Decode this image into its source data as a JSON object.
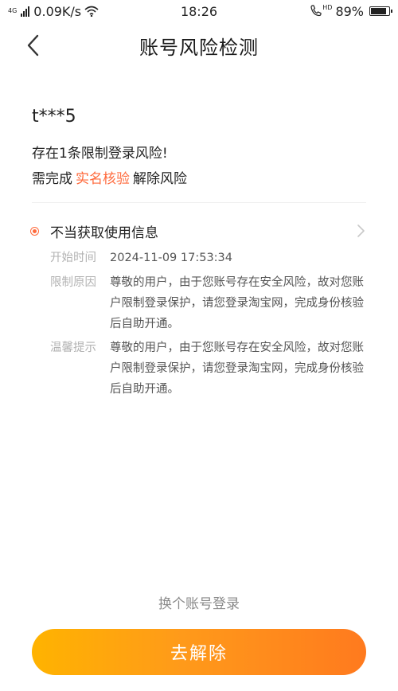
{
  "status_bar": {
    "network_label": "4G",
    "speed": "0.09K/s",
    "time": "18:26",
    "hd_label": "HD",
    "battery_percent": "89%",
    "battery_level": 0.89
  },
  "header": {
    "title": "账号风险检测"
  },
  "account": {
    "masked_name": "t***5"
  },
  "risk": {
    "summary": "存在1条限制登录风险!",
    "need_prefix": "需完成",
    "verify_link": "实名核验",
    "need_suffix": "解除风险"
  },
  "record": {
    "title": "不当获取使用信息",
    "details": [
      {
        "label": "开始时间",
        "value": "2024-11-09 17:53:34"
      },
      {
        "label": "限制原因",
        "value": "尊敬的用户，由于您账号存在安全风险，故对您账户限制登录保护，请您登录淘宝网，完成身份核验后自助开通。"
      },
      {
        "label": "温馨提示",
        "value": "尊敬的用户，由于您账号存在安全风险，故对您账户限制登录保护，请您登录淘宝网，完成身份核验后自助开通。"
      }
    ]
  },
  "footer": {
    "switch_account": "换个账号登录",
    "resolve_button": "去解除"
  },
  "colors": {
    "accent": "#ff6a3c",
    "button_gradient_start": "#ffb300",
    "button_gradient_end": "#ff7a1e"
  }
}
